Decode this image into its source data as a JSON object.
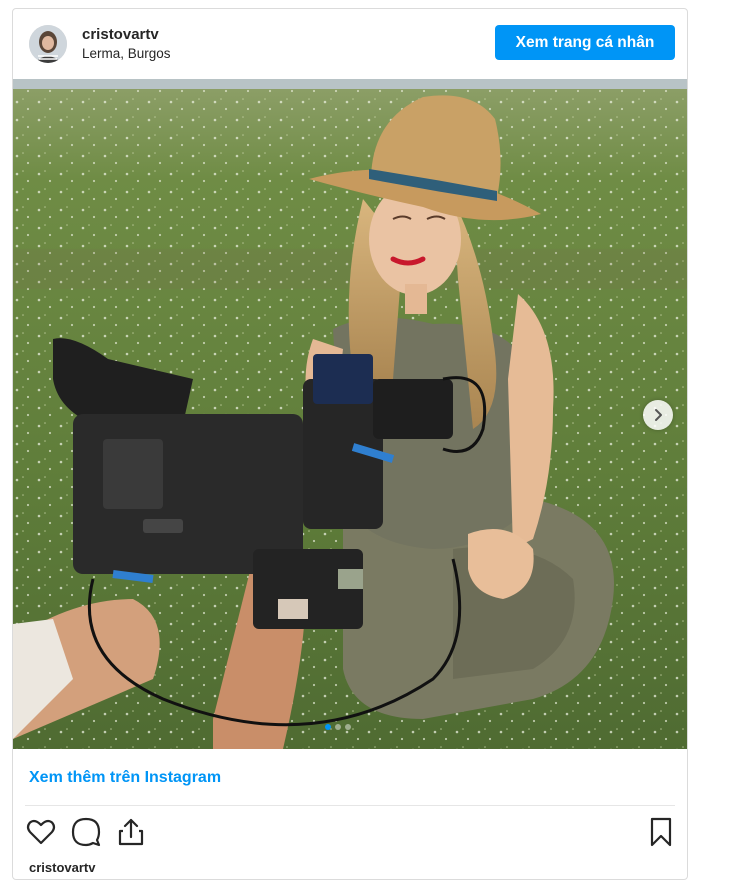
{
  "post": {
    "username": "cristovartv",
    "location": "Lerma, Burgos",
    "profile_button_label": "Xem trang cá nhân",
    "view_more_label": "Xem thêm trên Instagram",
    "caption_peek": "cristovartv"
  },
  "carousel": {
    "slide_count": 3,
    "active_index": 0
  },
  "icons": {
    "like": "heart-icon",
    "comment": "comment-icon",
    "share": "share-icon",
    "save": "bookmark-icon",
    "next": "chevron-right-icon"
  },
  "colors": {
    "accent": "#0095f6",
    "text": "#262626",
    "border": "#dbdbdb"
  }
}
